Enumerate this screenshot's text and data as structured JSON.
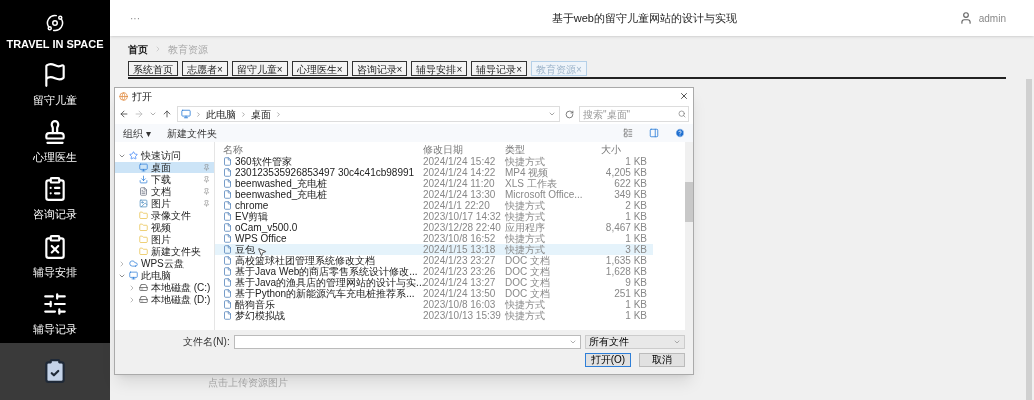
{
  "sidebar": {
    "brand": "TRAVEL IN SPACE",
    "items": [
      {
        "label": "留守儿童",
        "kind": "flag",
        "selected": false
      },
      {
        "label": "心理医生",
        "kind": "stamp",
        "selected": false
      },
      {
        "label": "咨询记录",
        "kind": "list",
        "selected": false
      },
      {
        "label": "辅导安排",
        "kind": "cross",
        "selected": false
      },
      {
        "label": "辅导记录",
        "kind": "sliders",
        "selected": false
      },
      {
        "kind": "check",
        "selected": true
      }
    ]
  },
  "header": {
    "more": "···",
    "title": "基于web的留守儿童网站的设计与实现",
    "user": "admin"
  },
  "breadcrumb": [
    "首页",
    "教育资源"
  ],
  "tabs": [
    {
      "label": "系统首页",
      "selected": false
    },
    {
      "label": "志愿者×",
      "selected": false
    },
    {
      "label": "留守儿童×",
      "selected": false
    },
    {
      "label": "心理医生×",
      "selected": false
    },
    {
      "label": "咨询记录×",
      "selected": false
    },
    {
      "label": "辅导安排×",
      "selected": false
    },
    {
      "label": "辅导记录×",
      "selected": false
    },
    {
      "label": "教育资源×",
      "selected": true
    }
  ],
  "upload_hint": "点击上传资源图片",
  "dialog": {
    "title": "打开",
    "path": [
      "此电脑",
      "桌面"
    ],
    "search": {
      "placeholder": "搜索\"桌面\""
    },
    "toolbar": [
      "组织 ▾",
      "新建文件夹"
    ],
    "nav": [
      {
        "label": "快速访问",
        "kind": "star",
        "expanded": true,
        "children": [
          {
            "label": "桌面",
            "kind": "desktop",
            "selected": true,
            "pinned": true
          },
          {
            "label": "下载",
            "kind": "download",
            "selected": false,
            "pinned": true
          },
          {
            "label": "文档",
            "kind": "doc",
            "selected": false,
            "pinned": true
          },
          {
            "label": "图片",
            "kind": "image",
            "selected": false,
            "pinned": true
          },
          {
            "label": "录像文件",
            "kind": "folder",
            "selected": false,
            "pinned": false
          },
          {
            "label": "视频",
            "kind": "folder",
            "selected": false,
            "pinned": false
          },
          {
            "label": "图片",
            "kind": "folder",
            "selected": false,
            "pinned": false
          },
          {
            "label": "新建文件夹",
            "kind": "folder",
            "selected": false,
            "pinned": false
          }
        ]
      },
      {
        "label": "WPS云盘",
        "kind": "cloud",
        "expanded": false
      },
      {
        "label": "此电脑",
        "kind": "pc",
        "expanded": true,
        "children": [
          {
            "label": "本地磁盘 (C:)",
            "kind": "disk",
            "selected": false,
            "expanded": false
          },
          {
            "label": "本地磁盘 (D:)",
            "kind": "disk",
            "selected": false,
            "expanded": false
          }
        ]
      }
    ],
    "columns": [
      "名称",
      "修改日期",
      "类型",
      "大小"
    ],
    "files": [
      {
        "name": "360软件管家",
        "modified": "2024/1/24 15:42",
        "type": "快捷方式",
        "size": "1 KB",
        "selected": false
      },
      {
        "name": "230123535926853497 30c4c41cb98991",
        "modified": "2024/1/24 14:22",
        "type": "MP4 视频",
        "size": "4,205 KB",
        "selected": false
      },
      {
        "name": "beenwashed_充电桩",
        "modified": "2024/1/24 11:20",
        "type": "XLS 工作表",
        "size": "622 KB",
        "selected": false
      },
      {
        "name": "beenwashed_充电桩",
        "modified": "2024/1/24 13:30",
        "type": "Microsoft Office...",
        "size": "349 KB",
        "selected": false
      },
      {
        "name": "chrome",
        "modified": "2024/1/1 22:20",
        "type": "快捷方式",
        "size": "2 KB",
        "selected": false
      },
      {
        "name": "EV剪辑",
        "modified": "2023/10/17 14:32",
        "type": "快捷方式",
        "size": "1 KB",
        "selected": false
      },
      {
        "name": "oCam_v500.0",
        "modified": "2023/12/28 22:40",
        "type": "应用程序",
        "size": "8,467 KB",
        "selected": false
      },
      {
        "name": "WPS Office",
        "modified": "2023/10/8 16:52",
        "type": "快捷方式",
        "size": "1 KB",
        "selected": false
      },
      {
        "name": "豆包",
        "modified": "2024/1/15 13:18",
        "type": "快捷方式",
        "size": "3 KB",
        "selected": true
      },
      {
        "name": "高校篮球社团管理系统修改文档",
        "modified": "2024/1/23 23:27",
        "type": "DOC 文档",
        "size": "1,635 KB",
        "selected": false
      },
      {
        "name": "基于Java Web的商店零售系统设计修改...",
        "modified": "2024/1/23 23:26",
        "type": "DOC 文档",
        "size": "1,628 KB",
        "selected": false
      },
      {
        "name": "基于Java的渔具店的管理网站的设计与实...",
        "modified": "2024/1/24 13:27",
        "type": "DOC 文档",
        "size": "9 KB",
        "selected": false
      },
      {
        "name": "基于Python的新能源汽车充电桩推荐系...",
        "modified": "2024/1/24 13:50",
        "type": "DOC 文档",
        "size": "251 KB",
        "selected": false
      },
      {
        "name": "酷狗音乐",
        "modified": "2023/10/8 16:03",
        "type": "快捷方式",
        "size": "1 KB",
        "selected": false
      },
      {
        "name": "梦幻模拟战",
        "modified": "2023/10/13 15:39",
        "type": "快捷方式",
        "size": "1 KB",
        "selected": false
      }
    ],
    "filename_label": "文件名(N):",
    "filter": "所有文件",
    "buttons": [
      "打开(O)",
      "取消"
    ]
  }
}
